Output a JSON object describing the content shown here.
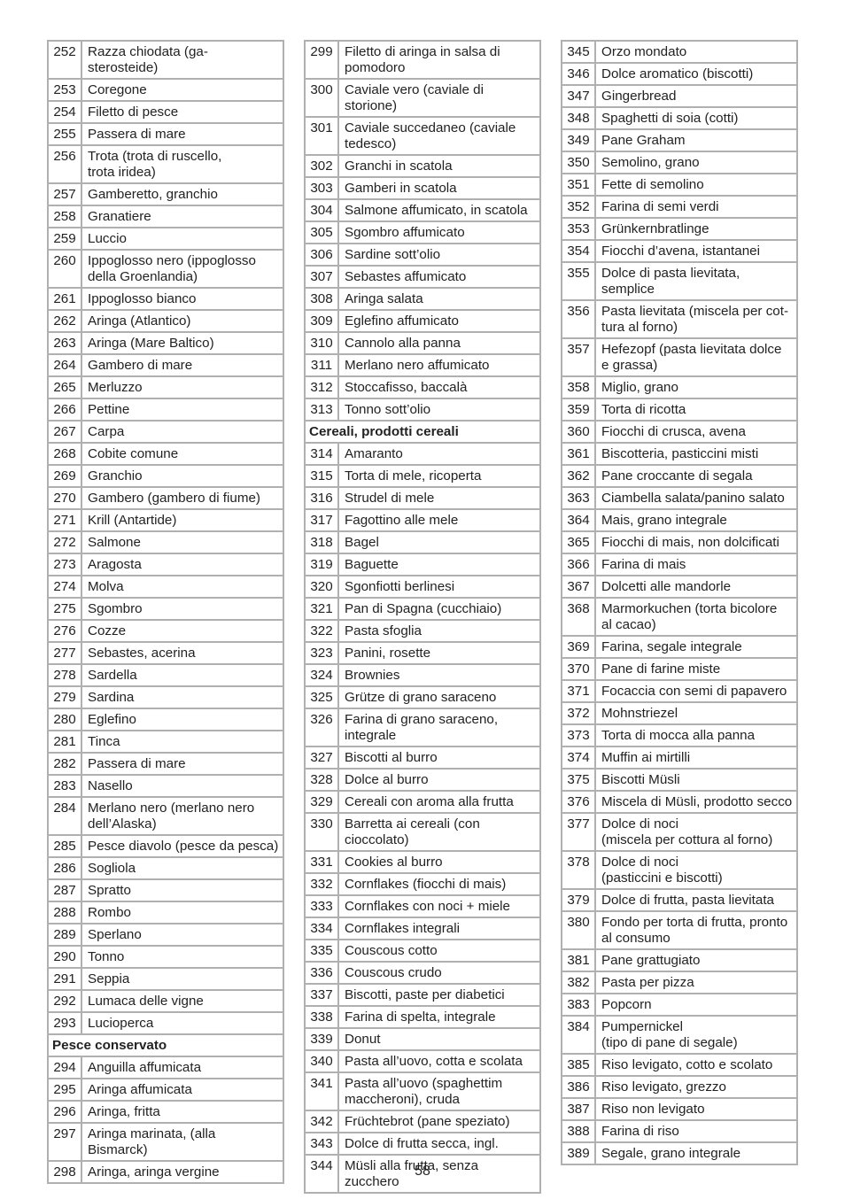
{
  "page_number": "58",
  "columns": [
    [
      {
        "n": "252",
        "t": "Razza chiodata (ga- sterosteide)"
      },
      {
        "n": "253",
        "t": "Coregone"
      },
      {
        "n": "254",
        "t": "Filetto di pesce"
      },
      {
        "n": "255",
        "t": "Passera di mare"
      },
      {
        "n": "256",
        "t": "Trota (trota di ruscello,\ntrota iridea)"
      },
      {
        "n": "257",
        "t": "Gamberetto, granchio"
      },
      {
        "n": "258",
        "t": "Granatiere"
      },
      {
        "n": "259",
        "t": "Luccio"
      },
      {
        "n": "260",
        "t": "Ippoglosso nero (ippoglosso\ndella Groenlandia)"
      },
      {
        "n": "261",
        "t": "Ippoglosso bianco"
      },
      {
        "n": "262",
        "t": "Aringa (Atlantico)"
      },
      {
        "n": "263",
        "t": "Aringa (Mare Baltico)"
      },
      {
        "n": "264",
        "t": "Gambero di mare"
      },
      {
        "n": "265",
        "t": "Merluzzo"
      },
      {
        "n": "266",
        "t": "Pettine"
      },
      {
        "n": "267",
        "t": "Carpa"
      },
      {
        "n": "268",
        "t": "Cobite comune"
      },
      {
        "n": "269",
        "t": "Granchio"
      },
      {
        "n": "270",
        "t": "Gambero (gambero di fiume)"
      },
      {
        "n": "271",
        "t": "Krill (Antartide)"
      },
      {
        "n": "272",
        "t": "Salmone"
      },
      {
        "n": "273",
        "t": "Aragosta"
      },
      {
        "n": "274",
        "t": "Molva"
      },
      {
        "n": "275",
        "t": "Sgombro"
      },
      {
        "n": "276",
        "t": "Cozze"
      },
      {
        "n": "277",
        "t": "Sebastes, acerina"
      },
      {
        "n": "278",
        "t": "Sardella"
      },
      {
        "n": "279",
        "t": "Sardina"
      },
      {
        "n": "280",
        "t": "Eglefino"
      },
      {
        "n": "281",
        "t": "Tinca"
      },
      {
        "n": "282",
        "t": "Passera di mare"
      },
      {
        "n": "283",
        "t": "Nasello"
      },
      {
        "n": "284",
        "t": "Merlano nero (merlano nero\ndell’Alaska)"
      },
      {
        "n": "285",
        "t": "Pesce diavolo (pesce da pesca)"
      },
      {
        "n": "286",
        "t": "Sogliola"
      },
      {
        "n": "287",
        "t": "Spratto"
      },
      {
        "n": "288",
        "t": "Rombo"
      },
      {
        "n": "289",
        "t": "Sperlano"
      },
      {
        "n": "290",
        "t": "Tonno"
      },
      {
        "n": "291",
        "t": "Seppia"
      },
      {
        "n": "292",
        "t": "Lumaca delle vigne"
      },
      {
        "n": "293",
        "t": "Lucioperca"
      },
      {
        "h": "Pesce conservato"
      },
      {
        "n": "294",
        "t": "Anguilla affumicata"
      },
      {
        "n": "295",
        "t": "Aringa affumicata"
      },
      {
        "n": "296",
        "t": "Aringa, fritta"
      },
      {
        "n": "297",
        "t": "Aringa marinata, (alla Bismarck)"
      },
      {
        "n": "298",
        "t": "Aringa, aringa vergine"
      }
    ],
    [
      {
        "n": "299",
        "t": "Filetto di aringa in salsa di\npomodoro"
      },
      {
        "n": "300",
        "t": "Caviale vero (caviale di storione)"
      },
      {
        "n": "301",
        "t": "Caviale succedaneo (caviale\ntedesco)"
      },
      {
        "n": "302",
        "t": "Granchi in scatola"
      },
      {
        "n": "303",
        "t": "Gamberi in scatola"
      },
      {
        "n": "304",
        "t": "Salmone affumicato, in scatola"
      },
      {
        "n": "305",
        "t": "Sgombro affumicato"
      },
      {
        "n": "306",
        "t": "Sardine sott’olio"
      },
      {
        "n": "307",
        "t": "Sebastes affumicato"
      },
      {
        "n": "308",
        "t": "Aringa salata"
      },
      {
        "n": "309",
        "t": "Eglefino affumicato"
      },
      {
        "n": "310",
        "t": "Cannolo alla panna"
      },
      {
        "n": "311",
        "t": "Merlano nero affumicato"
      },
      {
        "n": "312",
        "t": "Stoccafisso, baccalà"
      },
      {
        "n": "313",
        "t": "Tonno sott’olio"
      },
      {
        "h": "Cereali, prodotti cereali"
      },
      {
        "n": "314",
        "t": "Amaranto"
      },
      {
        "n": "315",
        "t": "Torta di mele, ricoperta"
      },
      {
        "n": "316",
        "t": "Strudel di mele"
      },
      {
        "n": "317",
        "t": "Fagottino alle mele"
      },
      {
        "n": "318",
        "t": "Bagel"
      },
      {
        "n": "319",
        "t": "Baguette"
      },
      {
        "n": "320",
        "t": "Sgonfiotti berlinesi"
      },
      {
        "n": "321",
        "t": "Pan di Spagna (cucchiaio)"
      },
      {
        "n": "322",
        "t": "Pasta sfoglia"
      },
      {
        "n": "323",
        "t": "Panini, rosette"
      },
      {
        "n": "324",
        "t": "Brownies"
      },
      {
        "n": "325",
        "t": "Grütze di grano saraceno"
      },
      {
        "n": "326",
        "t": "Farina di grano saraceno,\nintegrale"
      },
      {
        "n": "327",
        "t": "Biscotti al burro"
      },
      {
        "n": "328",
        "t": "Dolce al burro"
      },
      {
        "n": "329",
        "t": "Cereali con aroma alla frutta"
      },
      {
        "n": "330",
        "t": "Barretta ai cereali (con cioccolato)"
      },
      {
        "n": "331",
        "t": "Cookies al burro"
      },
      {
        "n": "332",
        "t": "Cornflakes (fiocchi di mais)"
      },
      {
        "n": "333",
        "t": "Cornflakes con noci + miele"
      },
      {
        "n": "334",
        "t": "Cornflakes integrali"
      },
      {
        "n": "335",
        "t": "Couscous cotto"
      },
      {
        "n": "336",
        "t": "Couscous crudo"
      },
      {
        "n": "337",
        "t": "Biscotti, paste per diabetici"
      },
      {
        "n": "338",
        "t": "Farina di spelta, integrale"
      },
      {
        "n": "339",
        "t": "Donut"
      },
      {
        "n": "340",
        "t": "Pasta all’uovo, cotta e scolata"
      },
      {
        "n": "341",
        "t": "Pasta all’uovo (spaghettim\nmaccheroni), cruda"
      },
      {
        "n": "342",
        "t": "Früchtebrot (pane speziato)"
      },
      {
        "n": "343",
        "t": "Dolce di frutta secca, ingl."
      },
      {
        "n": "344",
        "t": "Müsli alla frutta, senza zucchero"
      }
    ],
    [
      {
        "n": "345",
        "t": "Orzo mondato"
      },
      {
        "n": "346",
        "t": "Dolce aromatico (biscotti)"
      },
      {
        "n": "347",
        "t": "Gingerbread"
      },
      {
        "n": "348",
        "t": "Spaghetti di soia (cotti)"
      },
      {
        "n": "349",
        "t": "Pane Graham"
      },
      {
        "n": "350",
        "t": "Semolino, grano"
      },
      {
        "n": "351",
        "t": "Fette di semolino"
      },
      {
        "n": "352",
        "t": "Farina di semi verdi"
      },
      {
        "n": "353",
        "t": "Grünkernbratlinge"
      },
      {
        "n": "354",
        "t": "Fiocchi d’avena, istantanei"
      },
      {
        "n": "355",
        "t": "Dolce di pasta lievitata, semplice"
      },
      {
        "n": "356",
        "t": "Pasta lievitata (miscela per cot-\ntura al forno)"
      },
      {
        "n": "357",
        "t": "Hefezopf (pasta lievitata dolce\ne grassa)"
      },
      {
        "n": "358",
        "t": "Miglio, grano"
      },
      {
        "n": "359",
        "t": "Torta di ricotta"
      },
      {
        "n": "360",
        "t": "Fiocchi di crusca, avena"
      },
      {
        "n": "361",
        "t": "Biscotteria, pasticcini misti"
      },
      {
        "n": "362",
        "t": "Pane croccante di segala"
      },
      {
        "n": "363",
        "t": "Ciambella salata/panino salato"
      },
      {
        "n": "364",
        "t": "Mais, grano integrale"
      },
      {
        "n": "365",
        "t": "Fiocchi di mais, non dolcificati"
      },
      {
        "n": "366",
        "t": "Farina di mais"
      },
      {
        "n": "367",
        "t": "Dolcetti alle mandorle"
      },
      {
        "n": "368",
        "t": "Marmorkuchen (torta bicolore\nal cacao)"
      },
      {
        "n": "369",
        "t": "Farina, segale integrale"
      },
      {
        "n": "370",
        "t": "Pane di farine miste"
      },
      {
        "n": "371",
        "t": "Focaccia con semi di papavero"
      },
      {
        "n": "372",
        "t": "Mohnstriezel"
      },
      {
        "n": "373",
        "t": "Torta di mocca alla panna"
      },
      {
        "n": "374",
        "t": "Muffin ai mirtilli"
      },
      {
        "n": "375",
        "t": "Biscotti Müsli"
      },
      {
        "n": "376",
        "t": "Miscela di Müsli, prodotto secco"
      },
      {
        "n": "377",
        "t": "Dolce di noci\n(miscela per cottura al forno)"
      },
      {
        "n": "378",
        "t": "Dolce di noci\n(pasticcini e biscotti)"
      },
      {
        "n": "379",
        "t": "Dolce di frutta, pasta lievitata"
      },
      {
        "n": "380",
        "t": "Fondo per torta di frutta, pronto\nal consumo"
      },
      {
        "n": "381",
        "t": "Pane grattugiato"
      },
      {
        "n": "382",
        "t": "Pasta per pizza"
      },
      {
        "n": "383",
        "t": "Popcorn"
      },
      {
        "n": "384",
        "t": "Pumpernickel\n(tipo di pane di segale)"
      },
      {
        "n": "385",
        "t": "Riso levigato, cotto e scolato"
      },
      {
        "n": "386",
        "t": "Riso levigato, grezzo"
      },
      {
        "n": "387",
        "t": "Riso non levigato"
      },
      {
        "n": "388",
        "t": "Farina di riso"
      },
      {
        "n": "389",
        "t": "Segale, grano integrale"
      }
    ]
  ]
}
